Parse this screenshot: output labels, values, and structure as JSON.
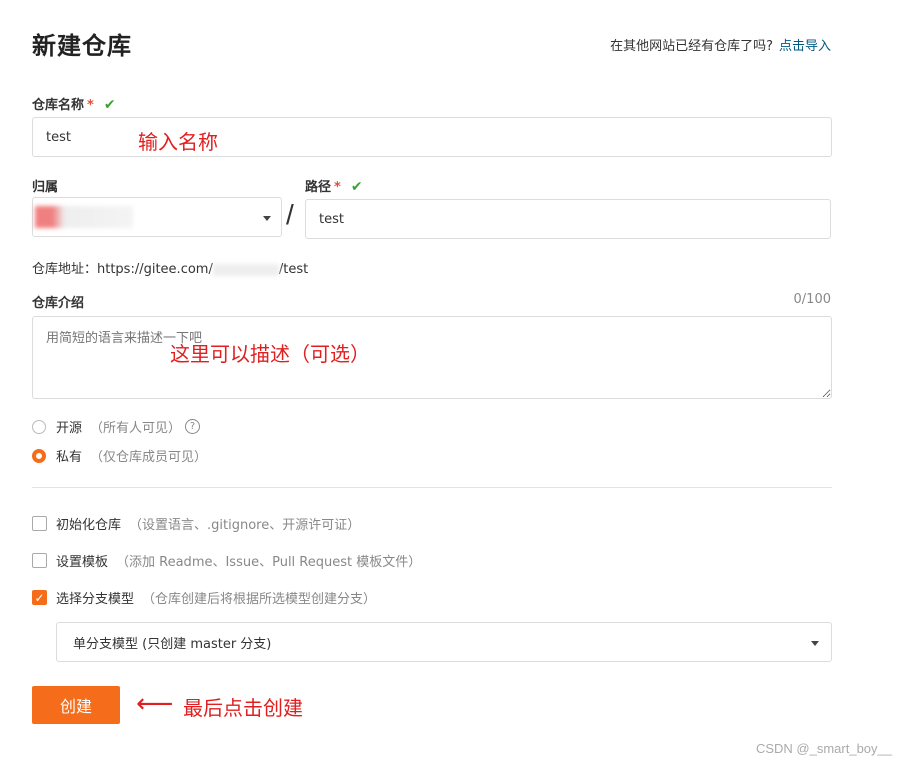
{
  "header": {
    "title": "新建仓库",
    "import_question": "在其他网站已经有仓库了吗?",
    "import_link": "点击导入"
  },
  "repo_name": {
    "label": "仓库名称",
    "required_mark": "*",
    "check": "✔",
    "value": "test",
    "annotation": "输入名称"
  },
  "owner": {
    "label": "归属",
    "value": ""
  },
  "separator": "/",
  "path": {
    "label": "路径",
    "required_mark": "*",
    "check": "✔",
    "value": "test"
  },
  "address": {
    "prefix": "仓库地址：https://gitee.com/",
    "suffix": "/test"
  },
  "description": {
    "label": "仓库介绍",
    "counter": "0/100",
    "placeholder": "用简短的语言来描述一下吧",
    "annotation": "这里可以描述（可选）"
  },
  "visibility": {
    "public": {
      "label": "开源",
      "hint": "（所有人可见）",
      "selected": false
    },
    "help_icon": "?",
    "private": {
      "label": "私有",
      "hint": "（仅仓库成员可见）",
      "selected": true
    }
  },
  "options": {
    "init": {
      "label": "初始化仓库",
      "hint": "（设置语言、.gitignore、开源许可证）",
      "checked": false
    },
    "template": {
      "label": "设置模板",
      "hint": "（添加 Readme、Issue、Pull Request 模板文件）",
      "checked": false
    },
    "branch": {
      "label": "选择分支模型",
      "hint": "（仓库创建后将根据所选模型创建分支）",
      "checked": true,
      "checkmark": "✓"
    }
  },
  "branch_model": {
    "selected": "单分支模型 (只创建 master 分支)"
  },
  "create_button": {
    "label": "创建"
  },
  "create_annotation": {
    "arrow": "⟵",
    "text": "最后点击创建"
  },
  "watermark": "CSDN @_smart_boy__",
  "colors": {
    "accent": "#f56c1a",
    "link": "#005980",
    "check": "#3aa335",
    "annotation": "#e02020"
  }
}
